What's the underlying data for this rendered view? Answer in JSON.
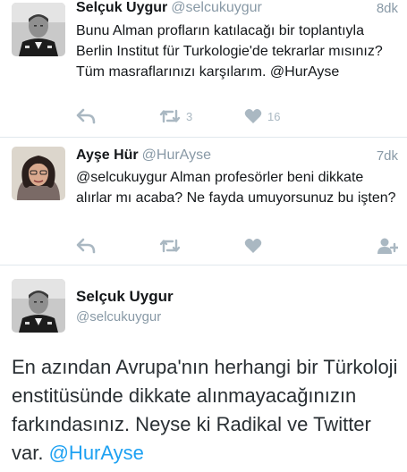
{
  "tweets": [
    {
      "name": "Selçuk Uygur",
      "handle": "@selcukuygur",
      "time": "8dk",
      "text": "Bunu Alman profların katılacağı bir toplantıyla Berlin Institut für Turkologie'de tekrarlar mısınız? Tüm masraflarınızı karşılarım. @HurAyse",
      "actions": {
        "retweets": "3",
        "likes": "16"
      }
    },
    {
      "name": "Ayşe Hür",
      "handle": "@HurAyse",
      "time": "7dk",
      "text": "@selcukuygur Alman profesörler beni dikkate alırlar mı acaba? Ne fayda umuyorsunuz bu işten?"
    }
  ],
  "detail": {
    "name": "Selçuk Uygur",
    "handle": "@selcukuygur",
    "text": "En azından Avrupa'nın herhangi bir Türkoloji enstitüsünde dikkate alınmayacağınızın farkındasınız. Neyse ki Radikal ve Twitter var.",
    "mention": "@HurAyse"
  },
  "icons": {
    "reply": "reply-icon",
    "retweet": "retweet-icon",
    "like": "heart-icon",
    "follow": "follow-icon"
  },
  "colors": {
    "icon_gray": "#aab8c2",
    "link_blue": "#1da1f2",
    "handle_gray": "#8899a6"
  }
}
